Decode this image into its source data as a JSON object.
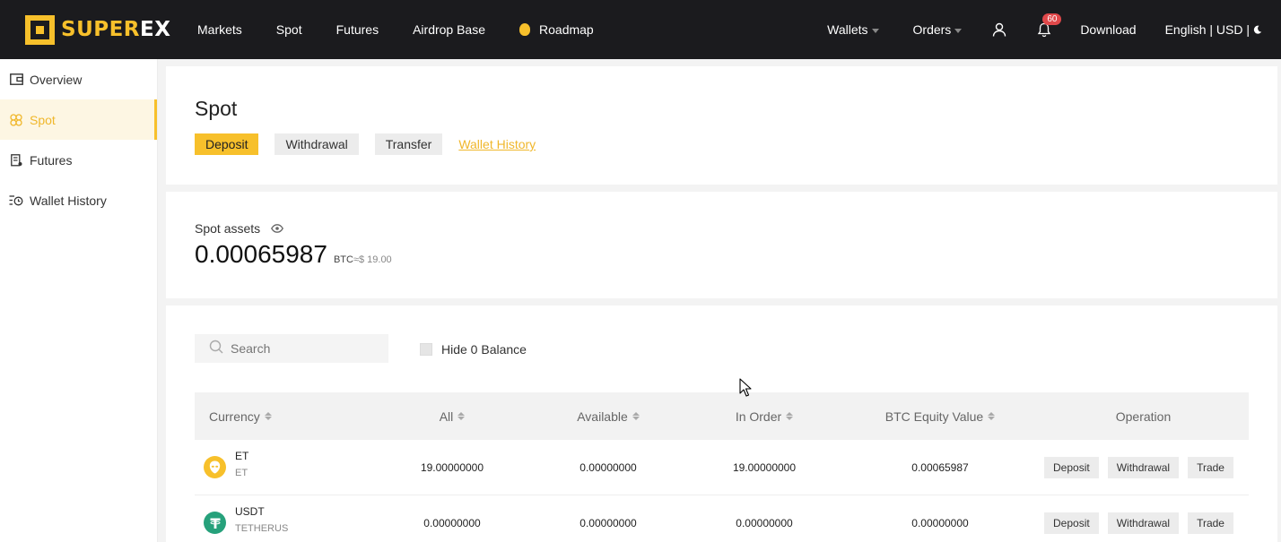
{
  "brand": {
    "super": "SUPER",
    "ex": "EX"
  },
  "nav": {
    "markets": "Markets",
    "spot": "Spot",
    "futures": "Futures",
    "airdrop": "Airdrop Base",
    "roadmap": "Roadmap",
    "wallets": "Wallets",
    "orders": "Orders",
    "notifications_count": "60",
    "download": "Download",
    "locale": "English | USD |"
  },
  "sidebar": {
    "items": [
      {
        "label": "Overview",
        "icon": "wallet-icon"
      },
      {
        "label": "Spot",
        "icon": "spot-icon",
        "active": true
      },
      {
        "label": "Futures",
        "icon": "futures-icon"
      },
      {
        "label": "Wallet History",
        "icon": "history-icon"
      }
    ]
  },
  "header": {
    "title": "Spot",
    "deposit": "Deposit",
    "withdrawal": "Withdrawal",
    "transfer": "Transfer",
    "wallet_history": "Wallet History"
  },
  "assets": {
    "label": "Spot assets",
    "value": "0.00065987",
    "unit": "BTC",
    "approx": "≈$ 19.00"
  },
  "filters": {
    "search_placeholder": "Search",
    "hide_zero": "Hide 0 Balance"
  },
  "table": {
    "columns": {
      "currency": "Currency",
      "all": "All",
      "available": "Available",
      "in_order": "In Order",
      "btc_value": "BTC Equity Value",
      "operation": "Operation"
    },
    "rows": [
      {
        "symbol": "ET",
        "name": "ET",
        "all": "19.00000000",
        "available": "0.00000000",
        "in_order": "19.00000000",
        "btc_value": "0.00065987",
        "deposit": "Deposit",
        "withdrawal": "Withdrawal",
        "trade": "Trade"
      },
      {
        "symbol": "USDT",
        "name": "TETHERUS",
        "all": "0.00000000",
        "available": "0.00000000",
        "in_order": "0.00000000",
        "btc_value": "0.00000000",
        "deposit": "Deposit",
        "withdrawal": "Withdrawal",
        "trade": "Trade"
      }
    ]
  },
  "colors": {
    "accent": "#f7c02b",
    "nav_bg": "#1b1b1e",
    "usdt": "#26a17b"
  }
}
